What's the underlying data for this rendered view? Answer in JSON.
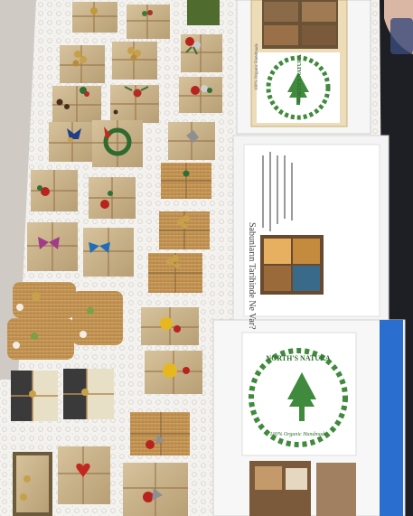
{
  "scene": {
    "description_colors": {
      "floor": "#dcd8d2",
      "tablecloth": "#f3f1ee",
      "lace": "#d9d6d2",
      "kraft_paper": "#c9b38c",
      "burlap": "#c59a5c",
      "twine": "#b58a55",
      "brochure_green": "#3f8a3c"
    }
  },
  "brochures": {
    "top": {
      "brand_line1": "NORTH'S",
      "brand_line2": "NATURA",
      "tagline": "100% Organic Handmade"
    },
    "middle": {
      "title": "Sabunların Tarihinde Ne Var?"
    },
    "bottom": {
      "brand": "NORTH'S NATURA",
      "tagline": "100% Organic Handmade"
    }
  }
}
